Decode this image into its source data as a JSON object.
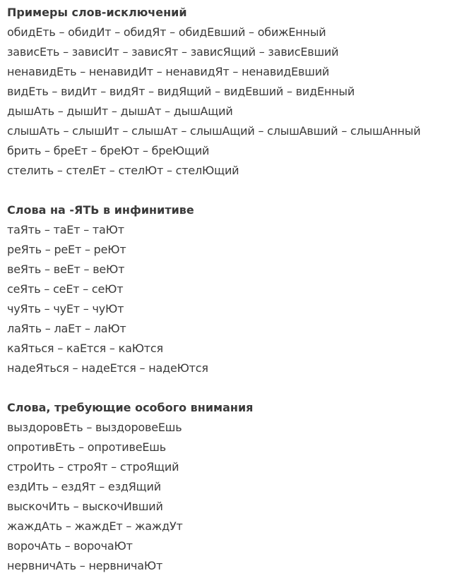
{
  "sections": [
    {
      "title": "Примеры слов-исключений",
      "lines": [
        "обидЕть – обидИт – обидЯт – обидЕвший – обижЕнный",
        "зависЕть – зависИт – зависЯт – зависЯщий – зависЕвший",
        "ненавидЕть – ненавидИт – ненавидЯт – ненавидЕвший",
        "видЕть – видИт – видЯт – видЯщий – видЕвший – видЕнный",
        "дышАть – дышИт – дышАт – дышАщий",
        "слышАть – слышИт – слышАт – слышАщий – слышАвший – слышАнный",
        "брить – бреЕт – бреЮт – бреЮщий",
        "стелить – стелЕт – стелЮт – стелЮщий"
      ]
    },
    {
      "title": "Слова на -ЯТЬ в инфинитиве",
      "lines": [
        "таЯть – таЕт – таЮт",
        "реЯть – реЕт – реЮт",
        "веЯть – веЕт – веЮт",
        "сеЯть – сеЕт – сеЮт",
        "чуЯть – чуЕт – чуЮт",
        "лаЯть – лаЕт – лаЮт",
        "каЯться – каЕтся – каЮтся",
        "надеЯться – надеЕтся – надеЮтся"
      ]
    },
    {
      "title": "Слова, требующие особого внимания",
      "lines": [
        "выздоровЕть – выздоровеЕшь",
        "опротивЕть – опротивеЕшь",
        "строИть – строЯт – строЯщий",
        "ездИть – ездЯт – ездЯщий",
        "выскочИть – выскочИвший",
        "жаждАть – жаждЕт – жаждУт",
        "ворочАть – ворочаЮт",
        "нервничАть – нервничаЮт"
      ]
    }
  ]
}
